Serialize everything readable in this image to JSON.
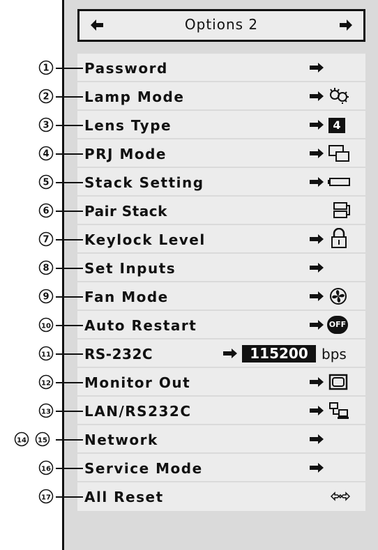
{
  "menu": {
    "title": "Options 2",
    "items": [
      {
        "num": "1",
        "label": "Password"
      },
      {
        "num": "2",
        "label": "Lamp Mode"
      },
      {
        "num": "3",
        "label": "Lens Type",
        "value": "4"
      },
      {
        "num": "4",
        "label": "PRJ Mode"
      },
      {
        "num": "5",
        "label": "Stack Setting"
      },
      {
        "num": "6",
        "label": "Pair Stack"
      },
      {
        "num": "7",
        "label": "Keylock Level"
      },
      {
        "num": "8",
        "label": "Set Inputs"
      },
      {
        "num": "9",
        "label": "Fan Mode"
      },
      {
        "num": "10",
        "label": "Auto Restart",
        "value": "OFF"
      },
      {
        "num": "11",
        "label": "RS-232C",
        "value": "115200",
        "unit": "bps"
      },
      {
        "num": "12",
        "label": "Monitor Out"
      },
      {
        "num": "13",
        "label": "LAN/RS232C"
      },
      {
        "num": "14",
        "num2": "15",
        "label": "Network"
      },
      {
        "num": "16",
        "label": "Service Mode"
      },
      {
        "num": "17",
        "label": "All Reset"
      }
    ]
  },
  "icons": {
    "title_left": "left-arrow-icon",
    "title_right": "right-arrow-icon",
    "row_arrow": "right-arrow-icon"
  },
  "colors": {
    "panel_bg": "#dadada",
    "row_bg": "#ececec",
    "ink": "#111111"
  }
}
